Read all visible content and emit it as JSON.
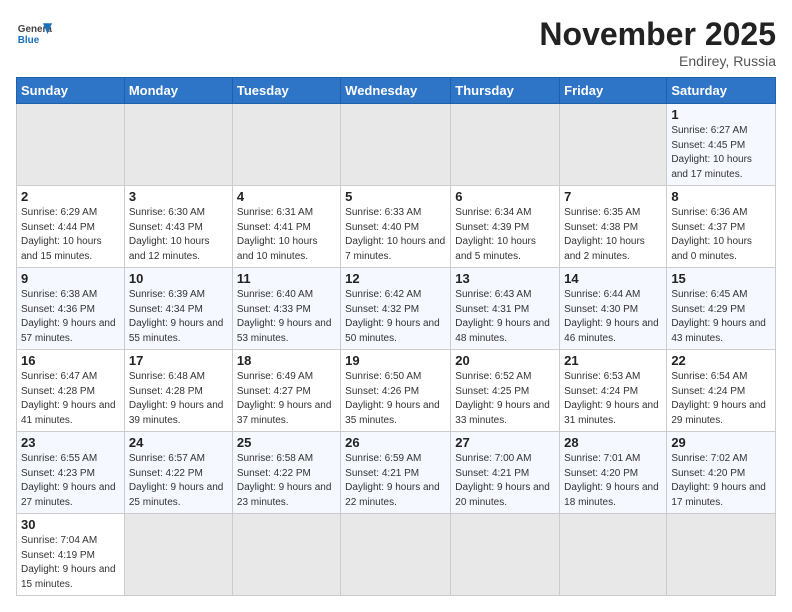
{
  "header": {
    "logo_general": "General",
    "logo_blue": "Blue",
    "month": "November 2025",
    "location": "Endirey, Russia"
  },
  "days_of_week": [
    "Sunday",
    "Monday",
    "Tuesday",
    "Wednesday",
    "Thursday",
    "Friday",
    "Saturday"
  ],
  "weeks": [
    [
      {
        "day": "",
        "info": ""
      },
      {
        "day": "",
        "info": ""
      },
      {
        "day": "",
        "info": ""
      },
      {
        "day": "",
        "info": ""
      },
      {
        "day": "",
        "info": ""
      },
      {
        "day": "",
        "info": ""
      },
      {
        "day": "1",
        "info": "Sunrise: 6:27 AM\nSunset: 4:45 PM\nDaylight: 10 hours and 17 minutes."
      }
    ],
    [
      {
        "day": "2",
        "info": "Sunrise: 6:29 AM\nSunset: 4:44 PM\nDaylight: 10 hours and 15 minutes."
      },
      {
        "day": "3",
        "info": "Sunrise: 6:30 AM\nSunset: 4:43 PM\nDaylight: 10 hours and 12 minutes."
      },
      {
        "day": "4",
        "info": "Sunrise: 6:31 AM\nSunset: 4:41 PM\nDaylight: 10 hours and 10 minutes."
      },
      {
        "day": "5",
        "info": "Sunrise: 6:33 AM\nSunset: 4:40 PM\nDaylight: 10 hours and 7 minutes."
      },
      {
        "day": "6",
        "info": "Sunrise: 6:34 AM\nSunset: 4:39 PM\nDaylight: 10 hours and 5 minutes."
      },
      {
        "day": "7",
        "info": "Sunrise: 6:35 AM\nSunset: 4:38 PM\nDaylight: 10 hours and 2 minutes."
      },
      {
        "day": "8",
        "info": "Sunrise: 6:36 AM\nSunset: 4:37 PM\nDaylight: 10 hours and 0 minutes."
      }
    ],
    [
      {
        "day": "9",
        "info": "Sunrise: 6:38 AM\nSunset: 4:36 PM\nDaylight: 9 hours and 57 minutes."
      },
      {
        "day": "10",
        "info": "Sunrise: 6:39 AM\nSunset: 4:34 PM\nDaylight: 9 hours and 55 minutes."
      },
      {
        "day": "11",
        "info": "Sunrise: 6:40 AM\nSunset: 4:33 PM\nDaylight: 9 hours and 53 minutes."
      },
      {
        "day": "12",
        "info": "Sunrise: 6:42 AM\nSunset: 4:32 PM\nDaylight: 9 hours and 50 minutes."
      },
      {
        "day": "13",
        "info": "Sunrise: 6:43 AM\nSunset: 4:31 PM\nDaylight: 9 hours and 48 minutes."
      },
      {
        "day": "14",
        "info": "Sunrise: 6:44 AM\nSunset: 4:30 PM\nDaylight: 9 hours and 46 minutes."
      },
      {
        "day": "15",
        "info": "Sunrise: 6:45 AM\nSunset: 4:29 PM\nDaylight: 9 hours and 43 minutes."
      }
    ],
    [
      {
        "day": "16",
        "info": "Sunrise: 6:47 AM\nSunset: 4:28 PM\nDaylight: 9 hours and 41 minutes."
      },
      {
        "day": "17",
        "info": "Sunrise: 6:48 AM\nSunset: 4:28 PM\nDaylight: 9 hours and 39 minutes."
      },
      {
        "day": "18",
        "info": "Sunrise: 6:49 AM\nSunset: 4:27 PM\nDaylight: 9 hours and 37 minutes."
      },
      {
        "day": "19",
        "info": "Sunrise: 6:50 AM\nSunset: 4:26 PM\nDaylight: 9 hours and 35 minutes."
      },
      {
        "day": "20",
        "info": "Sunrise: 6:52 AM\nSunset: 4:25 PM\nDaylight: 9 hours and 33 minutes."
      },
      {
        "day": "21",
        "info": "Sunrise: 6:53 AM\nSunset: 4:24 PM\nDaylight: 9 hours and 31 minutes."
      },
      {
        "day": "22",
        "info": "Sunrise: 6:54 AM\nSunset: 4:24 PM\nDaylight: 9 hours and 29 minutes."
      }
    ],
    [
      {
        "day": "23",
        "info": "Sunrise: 6:55 AM\nSunset: 4:23 PM\nDaylight: 9 hours and 27 minutes."
      },
      {
        "day": "24",
        "info": "Sunrise: 6:57 AM\nSunset: 4:22 PM\nDaylight: 9 hours and 25 minutes."
      },
      {
        "day": "25",
        "info": "Sunrise: 6:58 AM\nSunset: 4:22 PM\nDaylight: 9 hours and 23 minutes."
      },
      {
        "day": "26",
        "info": "Sunrise: 6:59 AM\nSunset: 4:21 PM\nDaylight: 9 hours and 22 minutes."
      },
      {
        "day": "27",
        "info": "Sunrise: 7:00 AM\nSunset: 4:21 PM\nDaylight: 9 hours and 20 minutes."
      },
      {
        "day": "28",
        "info": "Sunrise: 7:01 AM\nSunset: 4:20 PM\nDaylight: 9 hours and 18 minutes."
      },
      {
        "day": "29",
        "info": "Sunrise: 7:02 AM\nSunset: 4:20 PM\nDaylight: 9 hours and 17 minutes."
      }
    ],
    [
      {
        "day": "30",
        "info": "Sunrise: 7:04 AM\nSunset: 4:19 PM\nDaylight: 9 hours and 15 minutes."
      },
      {
        "day": "",
        "info": ""
      },
      {
        "day": "",
        "info": ""
      },
      {
        "day": "",
        "info": ""
      },
      {
        "day": "",
        "info": ""
      },
      {
        "day": "",
        "info": ""
      },
      {
        "day": "",
        "info": ""
      }
    ]
  ]
}
